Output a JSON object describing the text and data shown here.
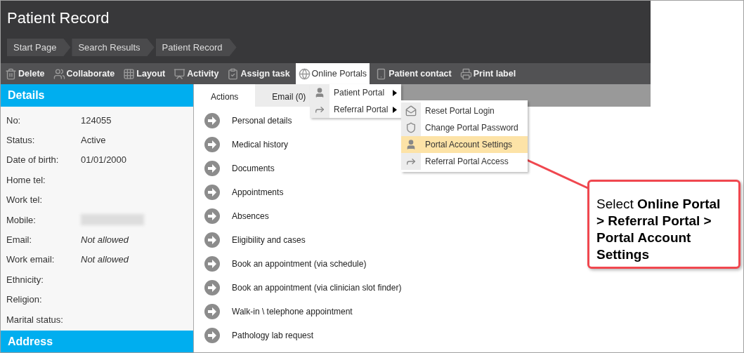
{
  "window": {
    "title": "Patient Record"
  },
  "breadcrumbs": [
    "Start Page",
    "Search Results",
    "Patient Record"
  ],
  "toolbar": [
    {
      "label": "Delete",
      "expanded": false
    },
    {
      "label": "Collaborate",
      "expanded": false
    },
    {
      "label": "Layout",
      "expanded": false
    },
    {
      "label": "Activity",
      "expanded": false
    },
    {
      "label": "Assign task",
      "expanded": false
    },
    {
      "label": "Online Portals",
      "expanded": true,
      "menu": [
        {
          "label": "Patient Portal",
          "expanded": false
        },
        {
          "label": "Referral Portal",
          "expanded": true,
          "submenu": [
            {
              "label": "Reset Portal Login",
              "selected": false
            },
            {
              "label": "Change Portal Password",
              "selected": false
            },
            {
              "label": "Portal Account Settings",
              "selected": true
            },
            {
              "label": "Referral Portal Access",
              "selected": false
            }
          ]
        }
      ]
    },
    {
      "label": "Patient contact",
      "expanded": false
    },
    {
      "label": "Print label",
      "expanded": false
    }
  ],
  "details": {
    "title": "Details",
    "fields": [
      {
        "label": "No:",
        "value": "124055",
        "kind": "text"
      },
      {
        "label": "Status:",
        "value": "Active",
        "kind": "text"
      },
      {
        "label": "Date of birth:",
        "value": "01/01/2000",
        "kind": "text"
      },
      {
        "label": "Home tel:",
        "kind": "text"
      },
      {
        "label": "Work tel:",
        "kind": "text"
      },
      {
        "label": "Mobile:",
        "kind": "redacted"
      },
      {
        "label": "Email:",
        "value": "Not allowed",
        "kind": "note"
      },
      {
        "label": "Work email:",
        "value": "Not allowed",
        "kind": "note"
      },
      {
        "label": "Ethnicity:",
        "kind": "text"
      },
      {
        "label": "Religion:",
        "kind": "text"
      },
      {
        "label": "Marital status:",
        "kind": "text"
      }
    ]
  },
  "address": {
    "title": "Address"
  },
  "tabs": [
    {
      "label": "Actions",
      "selected": true
    },
    {
      "label": "Email (0)",
      "selected": false
    }
  ],
  "actions": [
    "Personal details",
    "Medical history",
    "Documents",
    "Appointments",
    "Absences",
    "Eligibility and cases",
    "Book an appointment (via schedule)",
    "Book an appointment (via clinician slot finder)",
    "Walk-in \\ telephone appointment",
    "Pathology lab request"
  ],
  "callout": {
    "text": "Select **Online Portal > Referral Portal > Portal Account Settings**"
  }
}
